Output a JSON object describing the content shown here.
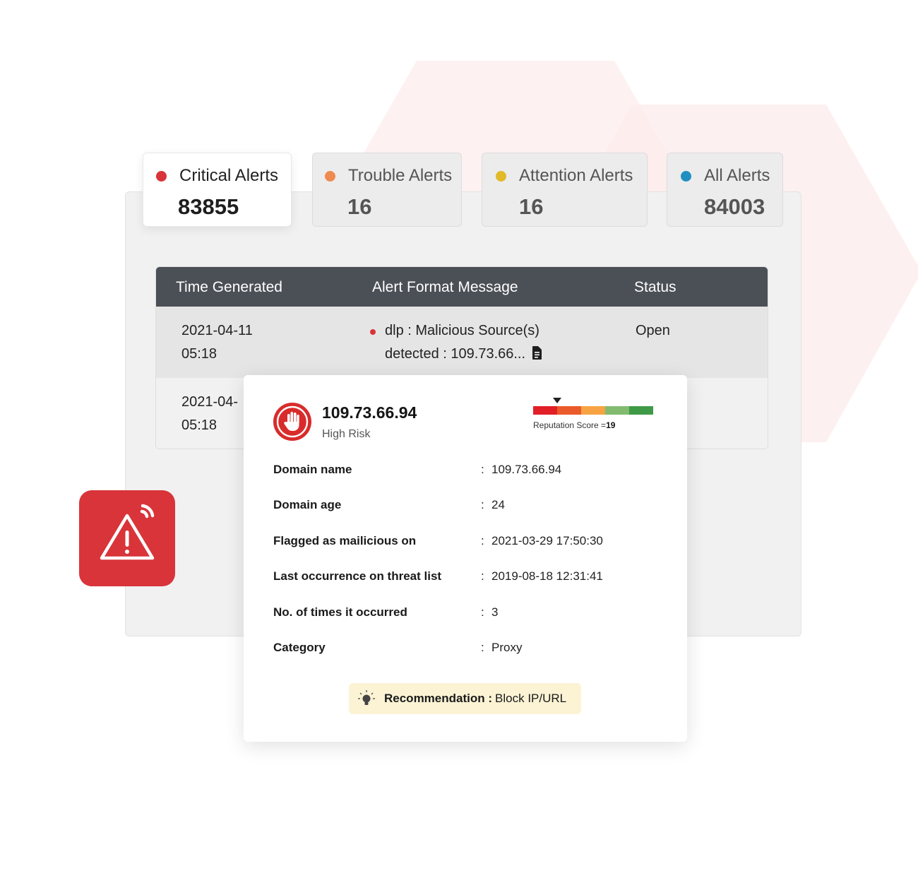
{
  "colors": {
    "critical": "#d8343a",
    "trouble": "#ef8a4f",
    "attention": "#e2b929",
    "all": "#1f8fc0",
    "table_header": "#4b4f56",
    "recommend_bg": "#fbf3d4",
    "reputation_scale": [
      "#e21f26",
      "#eb5a2a",
      "#f7a344",
      "#82bb70",
      "#3f9a48"
    ]
  },
  "tabs": [
    {
      "label": "Critical Alerts",
      "count": "83855",
      "color": "#d8343a",
      "active": true
    },
    {
      "label": "Trouble Alerts",
      "count": "16",
      "color": "#ef8a4f",
      "active": false
    },
    {
      "label": "Attention Alerts",
      "count": "16",
      "color": "#e2b929",
      "active": false
    },
    {
      "label": "All Alerts",
      "count": "84003",
      "color": "#1f8fc0",
      "active": false
    }
  ],
  "table": {
    "headers": [
      "Time Generated",
      "Alert Format Message",
      "Status"
    ],
    "rows": [
      {
        "date": "2021-04-11",
        "time": "05:18",
        "message_line1": "dlp : Malicious Source(s)",
        "message_line2": "detected : 109.73.66...",
        "status": "Open"
      },
      {
        "date": "2021-04-",
        "time": "05:18"
      }
    ]
  },
  "detail": {
    "icon": "hand-stop-icon",
    "ip": "109.73.66.94",
    "risk": "High Risk",
    "reputation_label": "Reputation Score =",
    "reputation_score": "19",
    "fields": [
      {
        "key": "Domain name",
        "sep": ":",
        "value": "109.73.66.94"
      },
      {
        "key": "Domain age",
        "sep": ":",
        "value": "24"
      },
      {
        "key": "Flagged as mailicious on",
        "sep": ":",
        "value": "2021-03-29 17:50:30"
      },
      {
        "key": "Last occurrence on threat list",
        "sep": ":",
        "value": "2019-08-18 12:31:41"
      },
      {
        "key": "No. of times it occurred",
        "sep": ":",
        "value": "3"
      },
      {
        "key": "Category",
        "sep": ":",
        "value": "Proxy"
      }
    ],
    "recommendation": {
      "icon": "lightbulb-icon",
      "label": "Recommendation :",
      "value": "Block IP/URL"
    }
  },
  "badge": {
    "icon": "alert-triangle-signal-icon"
  }
}
